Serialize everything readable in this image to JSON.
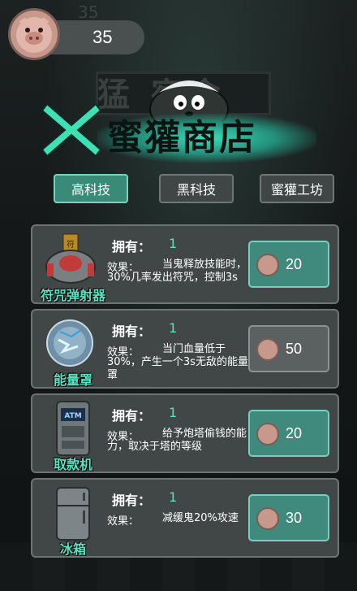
{
  "player": {
    "coins": "35"
  },
  "background": {
    "top_number": "35",
    "sign_text": "猛 宿舍"
  },
  "shop": {
    "title": "蜜獾商店",
    "tabs": [
      {
        "label": "高科技",
        "active": true
      },
      {
        "label": "黑科技",
        "active": false
      },
      {
        "label": "蜜獾工坊",
        "active": false
      }
    ],
    "own_label": "拥有：",
    "effect_label": "效果：",
    "items": [
      {
        "name": "符咒弹射器",
        "owned": "1",
        "effect": "当鬼释放技能时，30%几率发出符咒，控制3s",
        "price": "20",
        "affordable": true,
        "icon": "talisman-launcher-icon"
      },
      {
        "name": "能量罩",
        "owned": "1",
        "effect": "当门血量低于30%，产生一个3s无敌的能量罩",
        "price": "50",
        "affordable": false,
        "icon": "energy-shield-icon"
      },
      {
        "name": "取款机",
        "owned": "1",
        "effect": "给予炮塔偷钱的能力，取决于塔的等级",
        "price": "20",
        "affordable": true,
        "icon": "atm-icon"
      },
      {
        "name": "冰箱",
        "owned": "1",
        "effect": "减缓鬼20%攻速",
        "price": "30",
        "affordable": true,
        "icon": "fridge-icon"
      }
    ]
  },
  "colors": {
    "accent": "#5fe0c1",
    "button_green": "#3f8a7c",
    "button_gray": "#5b6160"
  }
}
